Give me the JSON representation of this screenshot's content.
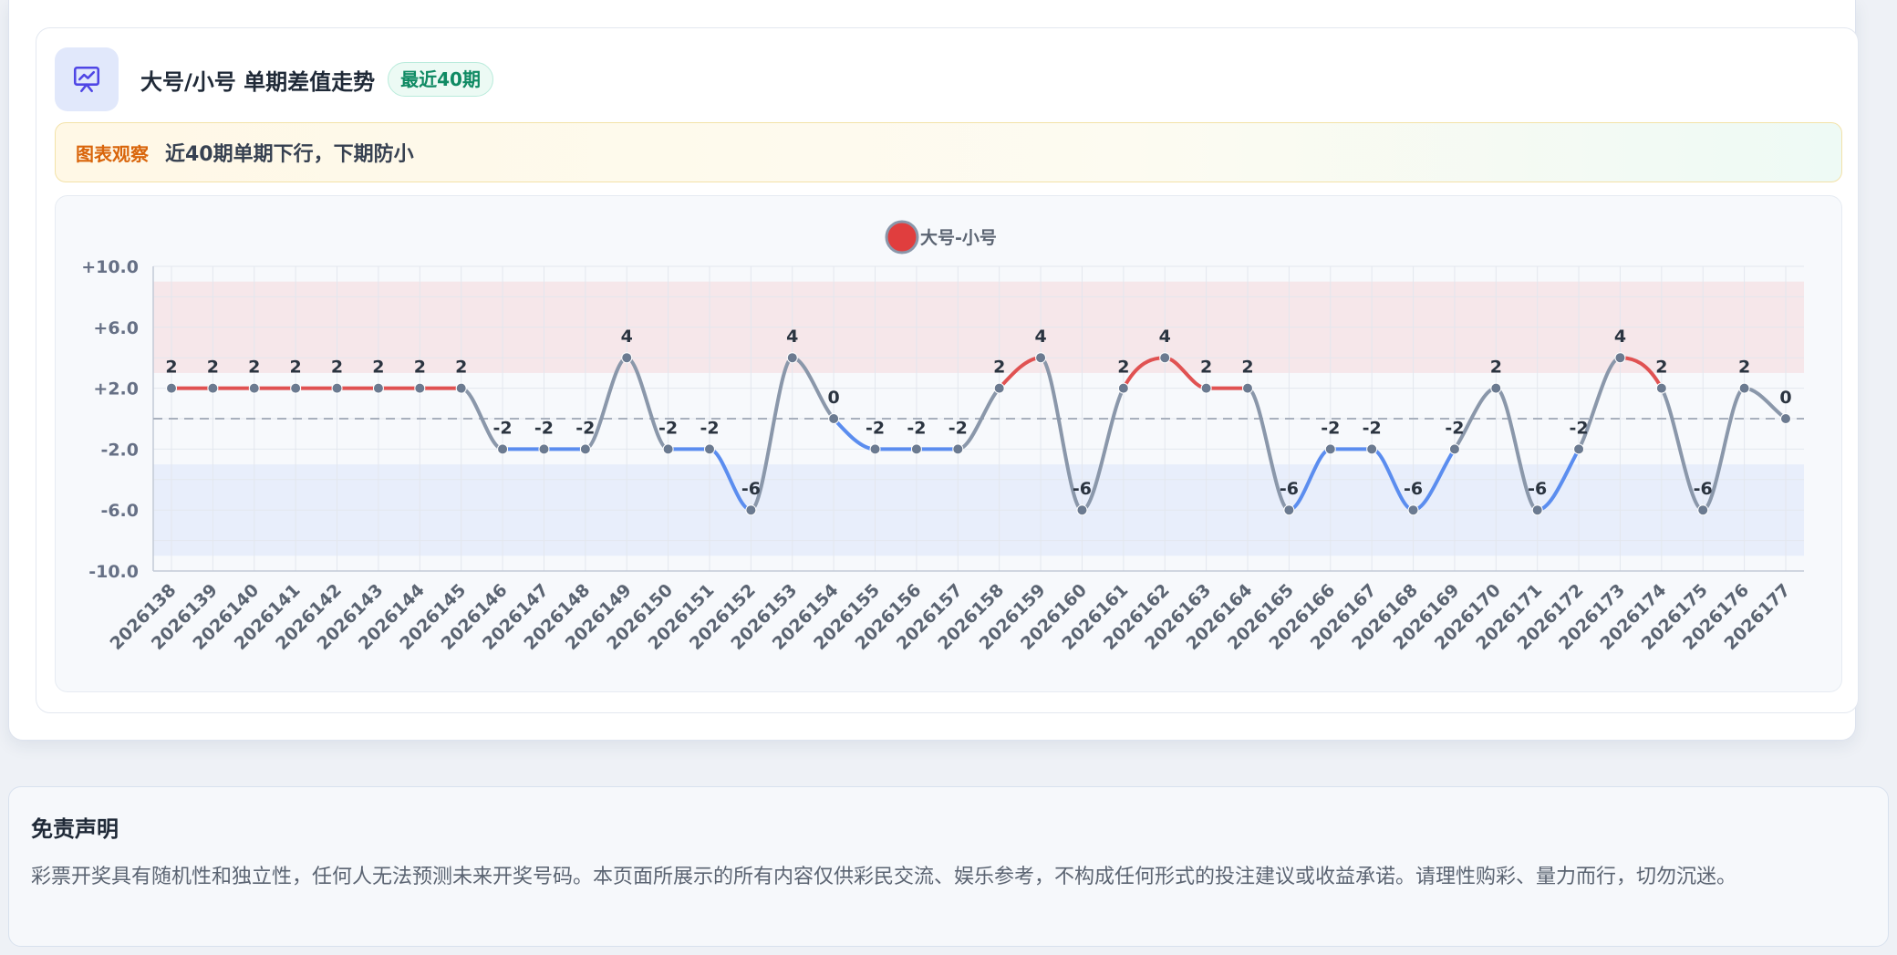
{
  "header": {
    "title": "大号/小号 单期差值走势",
    "badge": "最近40期",
    "icon": "presentation-chart-icon"
  },
  "observation": {
    "label": "图表观察",
    "text": "近40期单期下行，下期防小"
  },
  "chart_data": {
    "type": "line",
    "title": "",
    "xlabel": "",
    "ylabel": "",
    "categories": [
      "2026138",
      "2026139",
      "2026140",
      "2026141",
      "2026142",
      "2026143",
      "2026144",
      "2026145",
      "2026146",
      "2026147",
      "2026148",
      "2026149",
      "2026150",
      "2026151",
      "2026152",
      "2026153",
      "2026154",
      "2026155",
      "2026156",
      "2026157",
      "2026158",
      "2026159",
      "2026160",
      "2026161",
      "2026162",
      "2026163",
      "2026164",
      "2026165",
      "2026166",
      "2026167",
      "2026168",
      "2026169",
      "2026170",
      "2026171",
      "2026172",
      "2026173",
      "2026174",
      "2026175",
      "2026176",
      "2026177"
    ],
    "series": [
      {
        "name": "大号-小号",
        "values": [
          2,
          2,
          2,
          2,
          2,
          2,
          2,
          2,
          -2,
          -2,
          -2,
          4,
          -2,
          -2,
          -6,
          4,
          0,
          -2,
          -2,
          -2,
          2,
          4,
          -6,
          2,
          4,
          2,
          2,
          -6,
          -2,
          -2,
          -6,
          -2,
          2,
          -6,
          -2,
          4,
          2,
          -6,
          2,
          0
        ]
      }
    ],
    "ylim": [
      -10,
      10
    ],
    "yticks": [
      "-10.0",
      "-6.0",
      "-2.0",
      "+2.0",
      "+6.0",
      "+10.0"
    ],
    "ytick_values": [
      -10,
      -6,
      -2,
      2,
      6,
      10
    ],
    "bands": [
      {
        "from": 3,
        "to": 9,
        "color": "#f6e7ea"
      },
      {
        "from": -9,
        "to": -3,
        "color": "#e8eefb"
      }
    ],
    "reference_line": 0,
    "legend_position": "top-center",
    "grid": true,
    "colors": {
      "up": "#e05252",
      "down": "#5b8def",
      "neutral": "#8a97aa",
      "marker": "#6b7a90",
      "legend_dot": "#e03e3e"
    }
  },
  "disclaimer": {
    "title": "免责声明",
    "text": "彩票开奖具有随机性和独立性，任何人无法预测未来开奖号码。本页面所展示的所有内容仅供彩民交流、娱乐参考，不构成任何形式的投注建议或收益承诺。请理性购彩、量力而行，切勿沉迷。"
  }
}
